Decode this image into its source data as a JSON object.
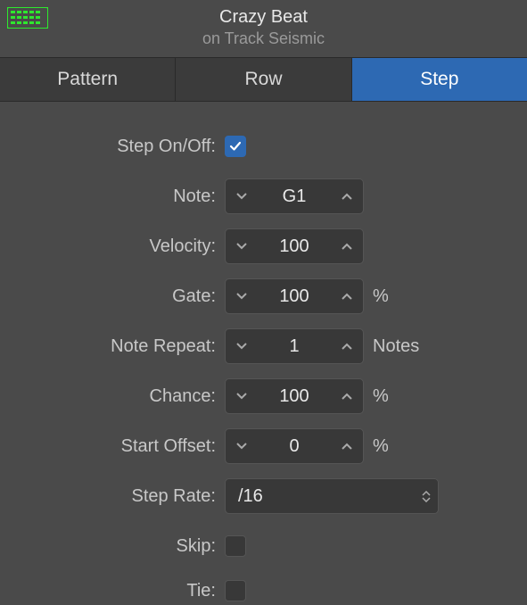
{
  "header": {
    "title": "Crazy Beat",
    "subtitle": "on Track Seismic"
  },
  "tabs": {
    "pattern": "Pattern",
    "row": "Row",
    "step": "Step"
  },
  "form": {
    "stepOnOff": {
      "label": "Step On/Off:",
      "checked": true
    },
    "note": {
      "label": "Note:",
      "value": "G1"
    },
    "velocity": {
      "label": "Velocity:",
      "value": "100"
    },
    "gate": {
      "label": "Gate:",
      "value": "100",
      "unit": "%"
    },
    "noteRepeat": {
      "label": "Note Repeat:",
      "value": "1",
      "unit": "Notes"
    },
    "chance": {
      "label": "Chance:",
      "value": "100",
      "unit": "%"
    },
    "startOffset": {
      "label": "Start Offset:",
      "value": "0",
      "unit": "%"
    },
    "stepRate": {
      "label": "Step Rate:",
      "value": "/16"
    },
    "skip": {
      "label": "Skip:",
      "checked": false
    },
    "tie": {
      "label": "Tie:",
      "checked": false
    }
  }
}
